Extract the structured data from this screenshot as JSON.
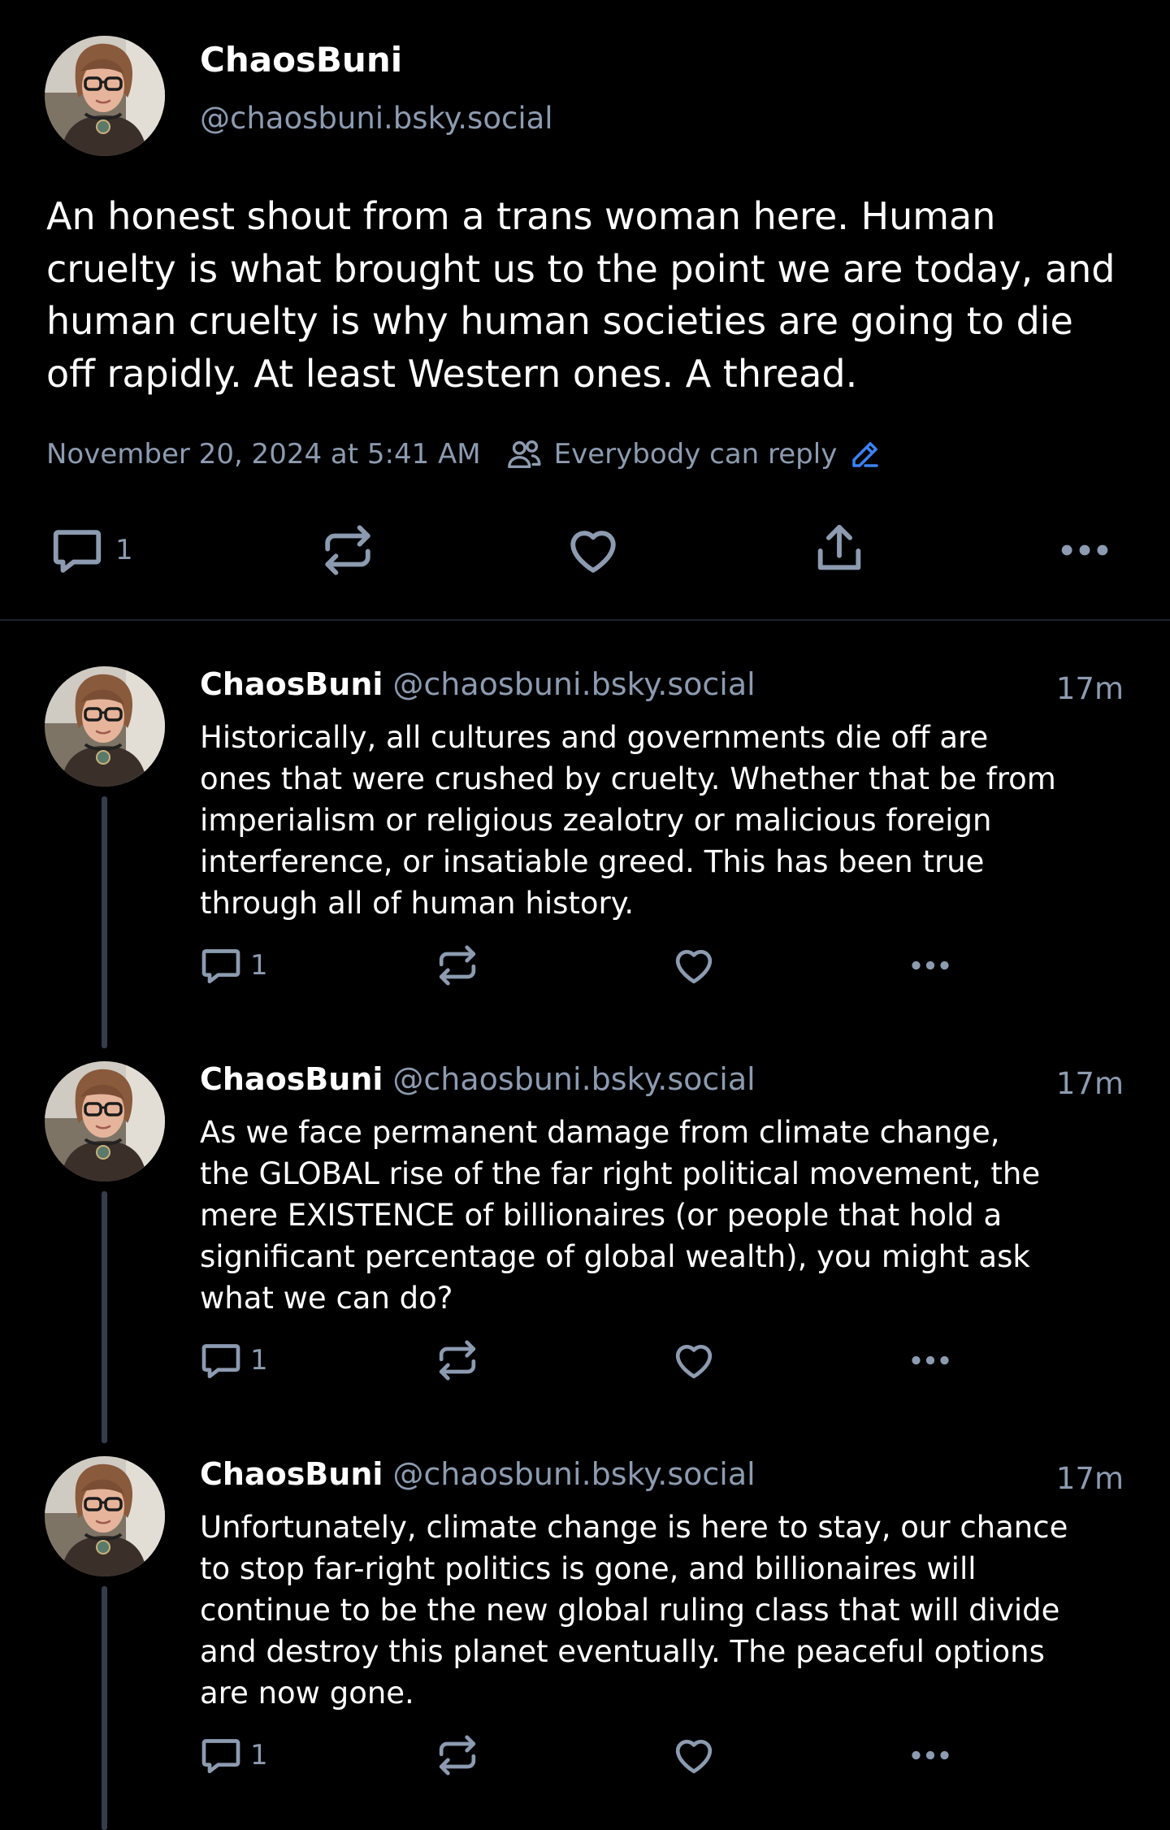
{
  "theme": {
    "background": "#000000",
    "text": "#ffffff",
    "muted": "#8c9bb0",
    "accent": "#3b82f6",
    "thread_line": "#343d4b"
  },
  "main_post": {
    "author": {
      "display_name": "ChaosBuni",
      "handle": "@chaosbuni.bsky.social",
      "avatar_icon": "avatar-photo"
    },
    "text": "An honest shout from a trans woman here. Human\ncruelty is what brought us to the point we are today, and\nhuman cruelty is why human societies are going to die\noff rapidly. At least Western ones. A thread.",
    "timestamp": "November 20, 2024 at 5:41 AM",
    "reply_setting": "Everybody can reply",
    "actions": {
      "reply_count": "1",
      "icons": [
        "reply-icon",
        "repost-icon",
        "like-icon",
        "share-icon",
        "more-icon"
      ]
    }
  },
  "replies": [
    {
      "display_name": "ChaosBuni",
      "handle": "@chaosbuni.bsky.social",
      "time": "17m",
      "text": "Historically, all cultures and governments die off are\nones that were crushed by cruelty. Whether that be from\nimperialism or religious zealotry or malicious foreign\ninterference, or insatiable greed. This has been true\nthrough all of human history.",
      "reply_count": "1"
    },
    {
      "display_name": "ChaosBuni",
      "handle": "@chaosbuni.bsky.social",
      "time": "17m",
      "text": "As we face permanent damage from climate change,\nthe GLOBAL rise of the far right political movement, the\nmere EXISTENCE of billionaires (or people that hold a\nsignificant percentage of global wealth), you might ask\nwhat we can do?",
      "reply_count": "1"
    },
    {
      "display_name": "ChaosBuni",
      "handle": "@chaosbuni.bsky.social",
      "time": "17m",
      "text": "Unfortunately, climate change is here to stay, our chance\nto stop far-right politics is gone, and billionaires will\ncontinue to be the new global ruling class that will divide\nand destroy this planet eventually. The peaceful options\nare now gone.",
      "reply_count": "1"
    }
  ]
}
